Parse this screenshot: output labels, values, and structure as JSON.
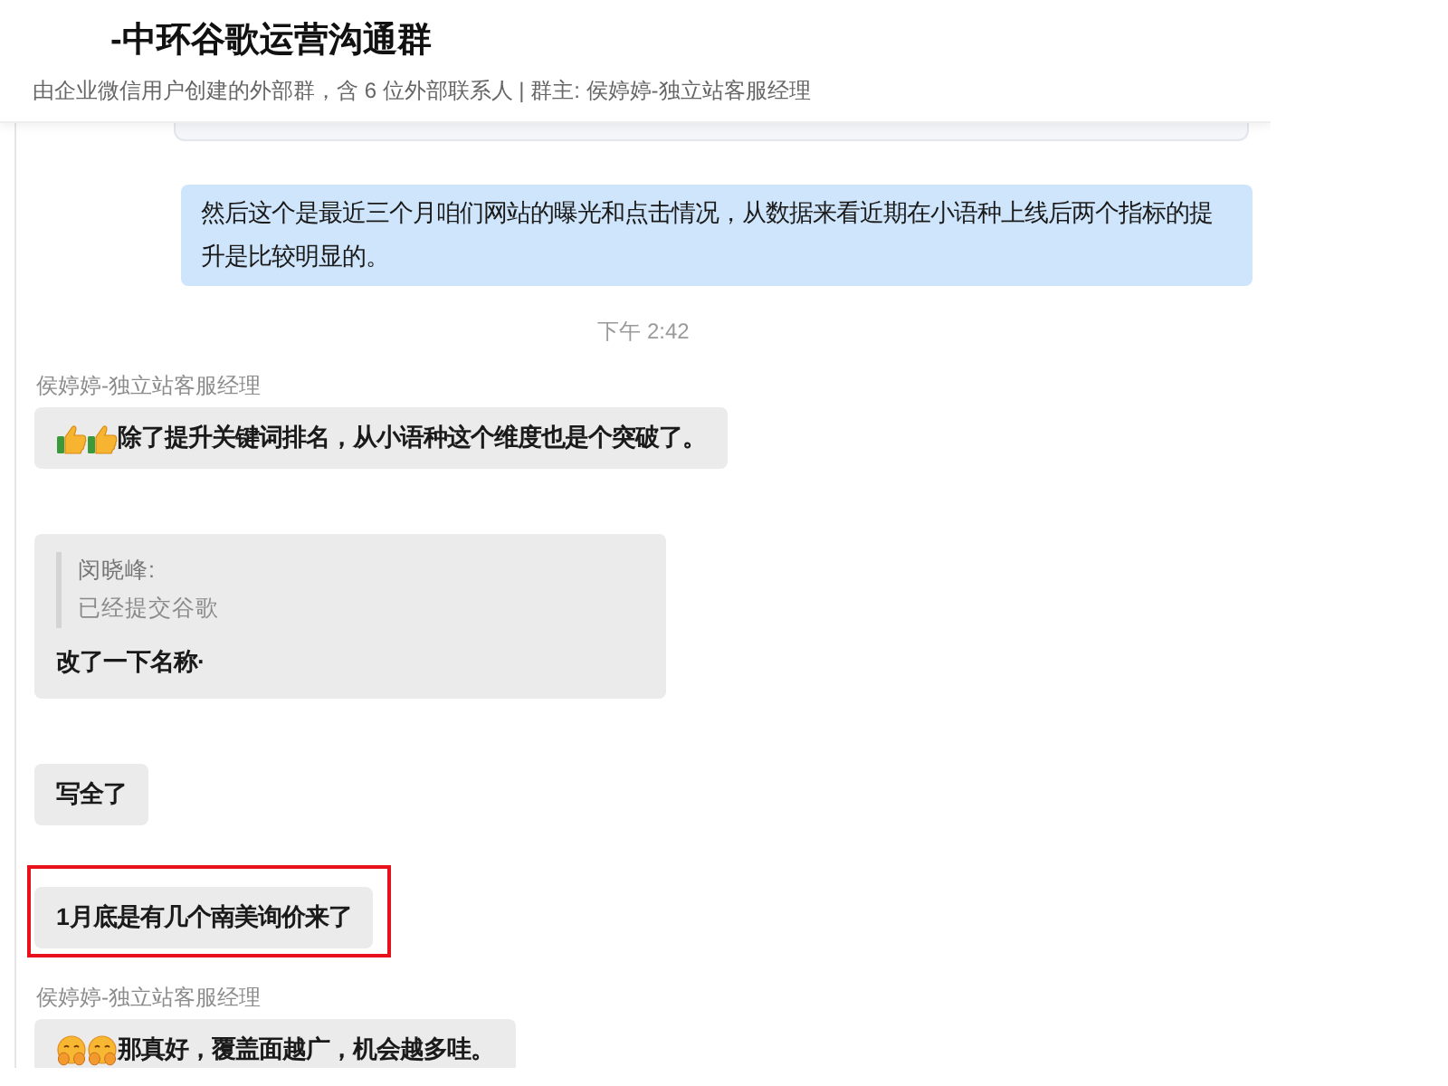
{
  "header": {
    "title": "-中环谷歌运营沟通群",
    "subtitle": "由企业微信用户创建的外部群，含 6 位外部联系人 | 群主: 侯婷婷-独立站客服经理"
  },
  "messages": [
    {
      "kind": "image"
    },
    {
      "kind": "text",
      "outgoing": true,
      "text": "然后这个是最近三个月咱们网站的曝光和点击情况，从数据来看近期在小语种上线后两个指标的提升是比较明显的。"
    },
    {
      "kind": "time",
      "text": "下午 2:42"
    },
    {
      "kind": "text",
      "outgoing": false,
      "sender": "侯婷婷-独立站客服经理",
      "emoji": [
        {
          "kind": "thumbs_up"
        },
        {
          "kind": "thumbs_up"
        }
      ],
      "text": "除了提升关键词排名，从小语种这个维度也是个突破了。"
    },
    {
      "kind": "quote",
      "outgoing": false,
      "quote": {
        "author": "闵晓峰:",
        "text": "已经提交谷歌"
      },
      "text": "改了一下名称·"
    },
    {
      "kind": "text",
      "outgoing": false,
      "text": "写全了"
    },
    {
      "kind": "text",
      "outgoing": false,
      "highlighted": true,
      "text": "1月底是有几个南美询价来了"
    },
    {
      "kind": "text",
      "outgoing": false,
      "sender": "侯婷婷-独立站客服经理",
      "emoji": [
        {
          "kind": "face"
        },
        {
          "kind": "face"
        }
      ],
      "text": "那真好，覆盖面越广，机会越多哇。"
    }
  ]
}
